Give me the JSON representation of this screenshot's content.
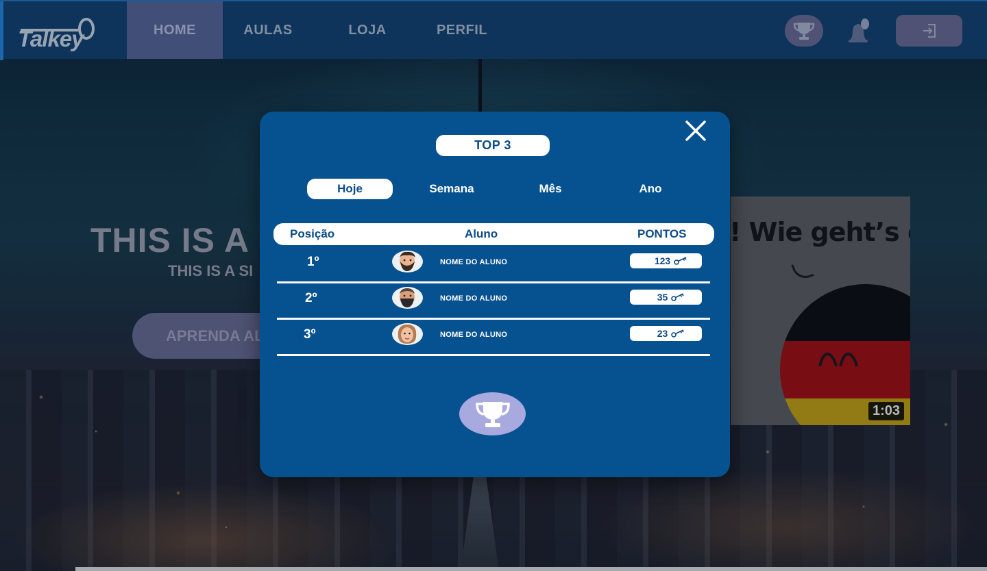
{
  "app": {
    "logo_text": "Talkey"
  },
  "nav": {
    "items": [
      {
        "label": "HOME",
        "active": true
      },
      {
        "label": "AULAS",
        "active": false
      },
      {
        "label": "LOJA",
        "active": false
      },
      {
        "label": "PERFIL",
        "active": false
      }
    ],
    "icons": [
      "trophy-icon",
      "bell-icon",
      "logout-icon"
    ]
  },
  "hero": {
    "title": "THIS IS A S",
    "subtitle": "THIS IS A SI",
    "cta_label": "APRENDA AL"
  },
  "video": {
    "caption": "! Wie geht’s dir",
    "duration": "1:03"
  },
  "modal": {
    "title": "TOP 3",
    "tabs": [
      {
        "label": "Hoje",
        "active": true
      },
      {
        "label": "Semana",
        "active": false
      },
      {
        "label": "Mês",
        "active": false
      },
      {
        "label": "Ano",
        "active": false
      }
    ],
    "columns": {
      "position": "Posição",
      "student": "Aluno",
      "points": "PONTOS"
    },
    "rows": [
      {
        "position": "1º",
        "name": "NOME DO ALUNO",
        "points": "123"
      },
      {
        "position": "2º",
        "name": "NOME DO ALUNO",
        "points": "35"
      },
      {
        "position": "3º",
        "name": "NOME DO ALUNO",
        "points": "23"
      }
    ]
  },
  "colors": {
    "navbar": "#0f3a66",
    "modal_bg": "#065190",
    "accent_purple": "#5e5f83",
    "trophy_button": "#a8a9de",
    "text_dark_blue": "#0b4a86"
  }
}
